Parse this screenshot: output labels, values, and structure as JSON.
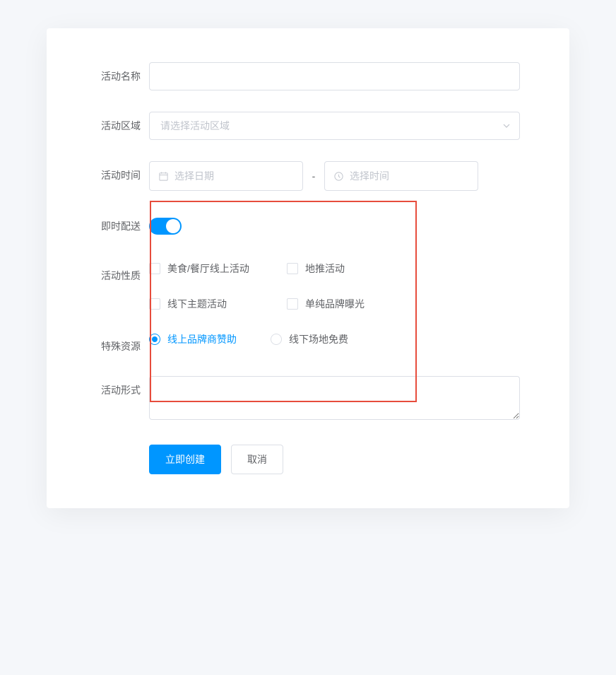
{
  "labels": {
    "name": "活动名称",
    "region": "活动区域",
    "time": "活动时间",
    "delivery": "即时配送",
    "nature": "活动性质",
    "resource": "特殊资源",
    "form": "活动形式"
  },
  "region": {
    "placeholder": "请选择活动区域",
    "value": ""
  },
  "name": {
    "value": ""
  },
  "datetime": {
    "date_placeholder": "选择日期",
    "time_placeholder": "选择时间",
    "separator": "-"
  },
  "delivery": {
    "on": true
  },
  "nature": {
    "options": [
      "美食/餐厅线上活动",
      "地推活动",
      "线下主题活动",
      "单纯品牌曝光"
    ]
  },
  "resource": {
    "options": [
      "线上品牌商赞助",
      "线下场地免费"
    ],
    "selected": 0
  },
  "formText": {
    "value": ""
  },
  "buttons": {
    "submit": "立即创建",
    "cancel": "取消"
  },
  "colors": {
    "primary": "#0096ff",
    "highlight_border": "#e74c3c"
  }
}
